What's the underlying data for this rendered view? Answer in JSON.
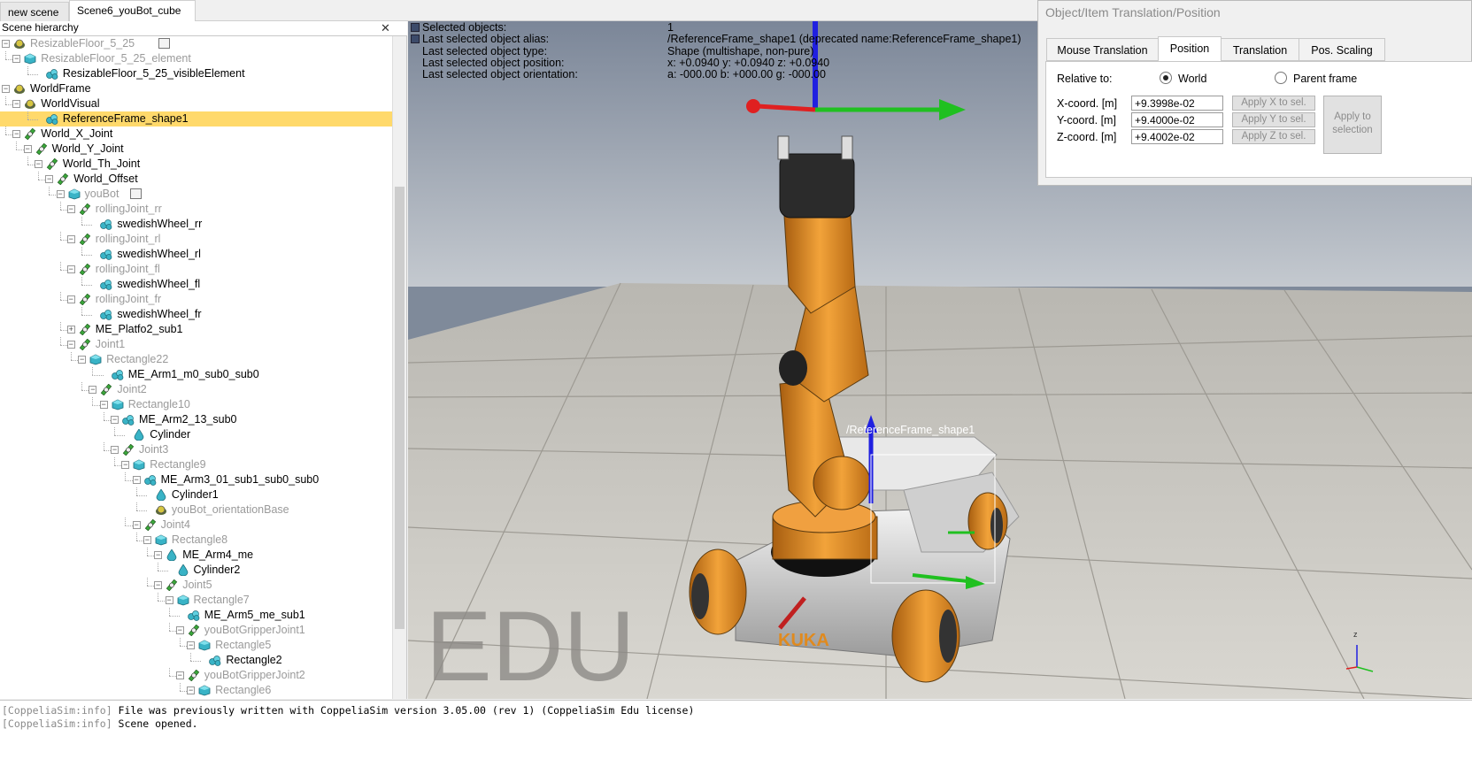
{
  "tabs": [
    {
      "label": "new scene",
      "active": false
    },
    {
      "label": "Scene6_youBot_cube",
      "active": true
    }
  ],
  "hierarchy": {
    "title": "Scene hierarchy",
    "close_icon": "close-icon",
    "items": [
      {
        "label": "ResizableFloor_5_25",
        "type": "model",
        "depth": 0,
        "expander": "-",
        "dim": true,
        "badge": true
      },
      {
        "label": "ResizableFloor_5_25_element",
        "type": "shape",
        "depth": 1,
        "expander": "-",
        "dim": true
      },
      {
        "label": "ResizableFloor_5_25_visibleElement",
        "type": "shape-pure",
        "depth": 3,
        "expander": "",
        "dim": false
      },
      {
        "label": "WorldFrame",
        "type": "model",
        "depth": 0,
        "expander": "-",
        "dim": false
      },
      {
        "label": "WorldVisual",
        "type": "model",
        "depth": 1,
        "expander": "-",
        "dim": false
      },
      {
        "label": "ReferenceFrame_shape1",
        "type": "shape-pure",
        "depth": 3,
        "expander": "",
        "dim": false,
        "selected": true
      },
      {
        "label": "World_X_Joint",
        "type": "joint",
        "depth": 1,
        "expander": "-",
        "dim": false
      },
      {
        "label": "World_Y_Joint",
        "type": "joint",
        "depth": 2,
        "expander": "-",
        "dim": false
      },
      {
        "label": "World_Th_Joint",
        "type": "joint",
        "depth": 3,
        "expander": "-",
        "dim": false
      },
      {
        "label": "World_Offset",
        "type": "joint",
        "depth": 4,
        "expander": "-",
        "dim": false
      },
      {
        "label": "youBot",
        "type": "shape",
        "depth": 5,
        "expander": "-",
        "dim": true,
        "badge": true
      },
      {
        "label": "rollingJoint_rr",
        "type": "joint",
        "depth": 6,
        "expander": "-",
        "dim": true
      },
      {
        "label": "swedishWheel_rr",
        "type": "shape-pure",
        "depth": 8,
        "expander": "",
        "dim": false
      },
      {
        "label": "rollingJoint_rl",
        "type": "joint",
        "depth": 6,
        "expander": "-",
        "dim": true
      },
      {
        "label": "swedishWheel_rl",
        "type": "shape-pure",
        "depth": 8,
        "expander": "",
        "dim": false
      },
      {
        "label": "rollingJoint_fl",
        "type": "joint",
        "depth": 6,
        "expander": "-",
        "dim": true
      },
      {
        "label": "swedishWheel_fl",
        "type": "shape-pure",
        "depth": 8,
        "expander": "",
        "dim": false
      },
      {
        "label": "rollingJoint_fr",
        "type": "joint",
        "depth": 6,
        "expander": "-",
        "dim": true
      },
      {
        "label": "swedishWheel_fr",
        "type": "shape-pure",
        "depth": 8,
        "expander": "",
        "dim": false
      },
      {
        "label": "ME_Platfo2_sub1",
        "type": "joint",
        "depth": 6,
        "expander": "+",
        "dim": false
      },
      {
        "label": "Joint1",
        "type": "joint",
        "depth": 6,
        "expander": "-",
        "dim": true
      },
      {
        "label": "Rectangle22",
        "type": "shape",
        "depth": 7,
        "expander": "-",
        "dim": true
      },
      {
        "label": "ME_Arm1_m0_sub0_sub0",
        "type": "shape-pure",
        "depth": 9,
        "expander": "",
        "dim": false
      },
      {
        "label": "Joint2",
        "type": "joint",
        "depth": 8,
        "expander": "-",
        "dim": true
      },
      {
        "label": "Rectangle10",
        "type": "shape",
        "depth": 9,
        "expander": "-",
        "dim": true
      },
      {
        "label": "ME_Arm2_13_sub0",
        "type": "shape-pure",
        "depth": 10,
        "expander": "-",
        "dim": false
      },
      {
        "label": "Cylinder",
        "type": "drop",
        "depth": 11,
        "expander": "",
        "dim": false
      },
      {
        "label": "Joint3",
        "type": "joint",
        "depth": 10,
        "expander": "-",
        "dim": true
      },
      {
        "label": "Rectangle9",
        "type": "shape",
        "depth": 11,
        "expander": "-",
        "dim": true
      },
      {
        "label": "ME_Arm3_01_sub1_sub0_sub0",
        "type": "shape-pure",
        "depth": 12,
        "expander": "-",
        "dim": false
      },
      {
        "label": "Cylinder1",
        "type": "drop",
        "depth": 13,
        "expander": "",
        "dim": false
      },
      {
        "label": "youBot_orientationBase",
        "type": "model",
        "depth": 13,
        "expander": "",
        "dim": true
      },
      {
        "label": "Joint4",
        "type": "joint",
        "depth": 12,
        "expander": "-",
        "dim": true
      },
      {
        "label": "Rectangle8",
        "type": "shape",
        "depth": 13,
        "expander": "-",
        "dim": true
      },
      {
        "label": "ME_Arm4_me",
        "type": "drop",
        "depth": 14,
        "expander": "-",
        "dim": false
      },
      {
        "label": "Cylinder2",
        "type": "drop",
        "depth": 15,
        "expander": "",
        "dim": false
      },
      {
        "label": "Joint5",
        "type": "joint",
        "depth": 14,
        "expander": "-",
        "dim": true
      },
      {
        "label": "Rectangle7",
        "type": "shape",
        "depth": 15,
        "expander": "-",
        "dim": true
      },
      {
        "label": "ME_Arm5_me_sub1",
        "type": "shape-pure",
        "depth": 16,
        "expander": "",
        "dim": false
      },
      {
        "label": "youBotGripperJoint1",
        "type": "joint",
        "depth": 16,
        "expander": "-",
        "dim": true
      },
      {
        "label": "Rectangle5",
        "type": "shape",
        "depth": 17,
        "expander": "-",
        "dim": true
      },
      {
        "label": "Rectangle2",
        "type": "shape-pure",
        "depth": 18,
        "expander": "",
        "dim": false
      },
      {
        "label": "youBotGripperJoint2",
        "type": "joint",
        "depth": 16,
        "expander": "-",
        "dim": true
      },
      {
        "label": "Rectangle6",
        "type": "shape",
        "depth": 17,
        "expander": "-",
        "dim": true
      }
    ]
  },
  "viewport": {
    "info": [
      {
        "label": "Selected objects:",
        "value": "1"
      },
      {
        "label": "Last selected object alias:",
        "value": "/ReferenceFrame_shape1   (deprecated name:ReferenceFrame_shape1)"
      },
      {
        "label": "Last selected object type:",
        "value": "Shape (multishape, non-pure)"
      },
      {
        "label": "Last selected object position:",
        "value": "x: +0.0940    y: +0.0940    z: +0.0940"
      },
      {
        "label": "Last selected object orientation:",
        "value": "a: -000.00    b: +000.00    g: -000.00"
      }
    ],
    "object_label": "/ReferenceFrame_shape1",
    "watermark": "EDU",
    "base_logo": "KUKA",
    "axis_label": "z"
  },
  "dialog": {
    "title": "Object/Item Translation/Position",
    "tabs": [
      {
        "label": "Mouse Translation",
        "active": false
      },
      {
        "label": "Position",
        "active": true
      },
      {
        "label": "Translation",
        "active": false
      },
      {
        "label": "Pos. Scaling",
        "active": false
      }
    ],
    "relative_to_label": "Relative to:",
    "radio_world": "World",
    "radio_parent": "Parent frame",
    "relative_to_selected": "World",
    "x_label": "X-coord. [m]",
    "y_label": "Y-coord. [m]",
    "z_label": "Z-coord. [m]",
    "x_value": "+9.3998e-02",
    "y_value": "+9.4000e-02",
    "z_value": "+9.4002e-02",
    "apply_x": "Apply X to sel.",
    "apply_y": "Apply Y to sel.",
    "apply_z": "Apply Z to sel.",
    "apply_sel_1": "Apply to",
    "apply_sel_2": "selection"
  },
  "console": {
    "lines": [
      {
        "prefix": "[CoppeliaSim:info]",
        "text": " File was previously written with CoppeliaSim version 3.05.00 (rev 1) (CoppeliaSim Edu license)"
      },
      {
        "prefix": "[CoppeliaSim:info]",
        "text": " Scene opened."
      }
    ]
  },
  "colors": {
    "selection": "#ffd96b",
    "x_axis": "#e02020",
    "y_axis": "#20c020",
    "z_axis": "#2020e0",
    "robot_orange": "#e08a1e"
  }
}
